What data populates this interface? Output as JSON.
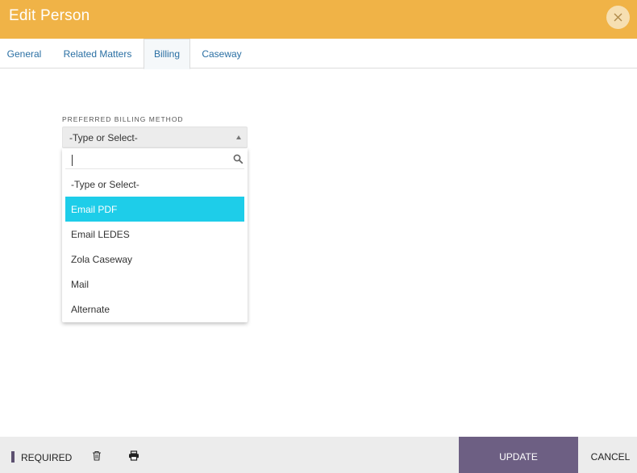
{
  "window": {
    "title": "Edit Person",
    "close_icon": "close-icon"
  },
  "tabs": [
    {
      "label": "General"
    },
    {
      "label": "Related Matters"
    },
    {
      "label": "Billing",
      "active": true
    },
    {
      "label": "Caseway"
    }
  ],
  "billing": {
    "field_label": "PREFERRED BILLING METHOD",
    "select_value": "-Type or Select-",
    "dropdown": {
      "search_value": "",
      "search_icon": "search-icon",
      "options": [
        {
          "label": "-Type or Select-"
        },
        {
          "label": "Email PDF",
          "highlighted": true
        },
        {
          "label": "Email LEDES"
        },
        {
          "label": "Zola Caseway"
        },
        {
          "label": "Mail"
        },
        {
          "label": "Alternate"
        }
      ]
    }
  },
  "footer": {
    "required_label": "REQUIRED",
    "delete_icon": "trash-icon",
    "print_icon": "printer-icon",
    "update_label": "UPDATE",
    "cancel_label": "CANCEL"
  },
  "colors": {
    "header": "#f0b347",
    "accent_tab": "#2a6fa3",
    "selected_option": "#1ecde9",
    "update_button": "#6d5f83"
  }
}
